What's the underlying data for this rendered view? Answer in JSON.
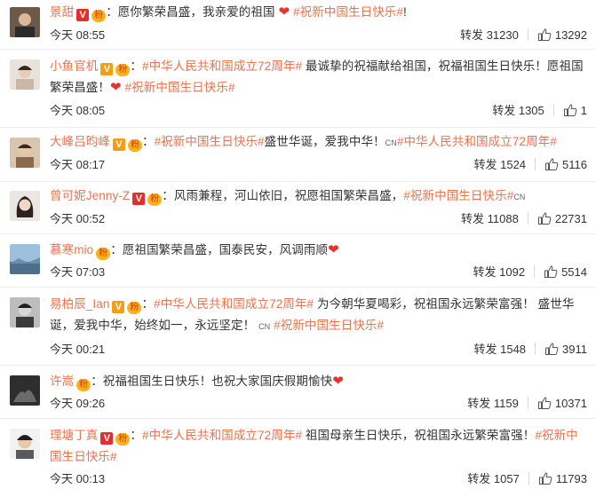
{
  "labels": {
    "repost": "转发"
  },
  "comments": [
    {
      "user": "景甜",
      "v": "red",
      "fan": true,
      "text_a": "：愿你繁荣昌盛，我亲爱的祖国 ",
      "heart": "❤",
      "text_b": " ",
      "topic": "#祝新中国生日快乐#",
      "text_c": "!",
      "time": "今天 08:55",
      "reposts": "31230",
      "likes": "13292",
      "avatar_color": "#6b5a48"
    },
    {
      "user": "小鱼官机",
      "v": "gold",
      "fan": true,
      "pre": "：",
      "topic1": "#中华人民共和国成立72周年#",
      "text_a": " 最诚挚的祝福献给祖国，祝福祖国生日快乐！愿祖国繁荣昌盛！",
      "heart": "❤",
      "text_b": " ",
      "topic2": "#祝新中国生日快乐#",
      "time": "今天 08:05",
      "reposts": "1305",
      "likes": "1",
      "avatar_color": "#c9b8a8"
    },
    {
      "user": "大峰吕昀峰",
      "v": "gold",
      "fan": true,
      "pre": "：",
      "topic1": "#祝新中国生日快乐#",
      "text_a": "盛世华诞，爱我中华！",
      "cn": "CN",
      "topic2": "#中华人民共和国成立72周年#",
      "time": "今天 08:17",
      "reposts": "1524",
      "likes": "5116",
      "avatar_color": "#8a6a4a"
    },
    {
      "user": "曾可妮Jenny-Z",
      "v": "red",
      "fan": true,
      "text_a": "：风雨兼程，河山依旧，祝愿祖国繁荣昌盛，",
      "topic": "#祝新中国生日快乐#",
      "cn": "CN",
      "time": "今天 00:52",
      "reposts": "11088",
      "likes": "22731",
      "avatar_color": "#d8c8c0"
    },
    {
      "user": "慕寒mio",
      "fan": true,
      "text_a": "：愿祖国繁荣昌盛，国泰民安，风调雨顺",
      "heart": "❤",
      "time": "今天 07:03",
      "reposts": "1092",
      "likes": "5514",
      "avatar_color": "#7fa7c8"
    },
    {
      "user": "易柏辰_Ian",
      "v": "gold",
      "fan": true,
      "pre": "：",
      "topic1": "#中华人民共和国成立72周年#",
      "text_a": " 为今朝华夏喝彩，祝祖国永远繁荣富强！ 盛世华诞，爱我中华，始终如一，永远坚定！",
      "cn": "CN",
      "topic2": "#祝新中国生日快乐#",
      "time": "今天 00:21",
      "reposts": "1548",
      "likes": "3911",
      "avatar_color": "#3a3a3a"
    },
    {
      "user": "许嵩",
      "fan": true,
      "text_a": "：祝福祖国生日快乐！也祝大家国庆假期愉快",
      "heart": "❤",
      "time": "今天 09:26",
      "reposts": "1159",
      "likes": "10371",
      "avatar_color": "#2e2e2e"
    },
    {
      "user": "理塘丁真",
      "v": "red",
      "fan": true,
      "pre": "：",
      "topic1": "#中华人民共和国成立72周年#",
      "text_a": " 祖国母亲生日快乐，祝祖国永远繁荣富强！",
      "topic2": "#祝新中国生日快乐#",
      "time": "今天 00:13",
      "reposts": "1057",
      "likes": "11793",
      "avatar_color": "#f2f2f2"
    }
  ],
  "colors": {
    "accent": "#eb7350",
    "heart": "#e8322e",
    "v_red": "#e52d2d",
    "v_gold": "#f59d13"
  },
  "icons": {
    "like": "thumb-up-icon",
    "verified": "verified-v-icon",
    "fan": "fan-badge-icon"
  }
}
